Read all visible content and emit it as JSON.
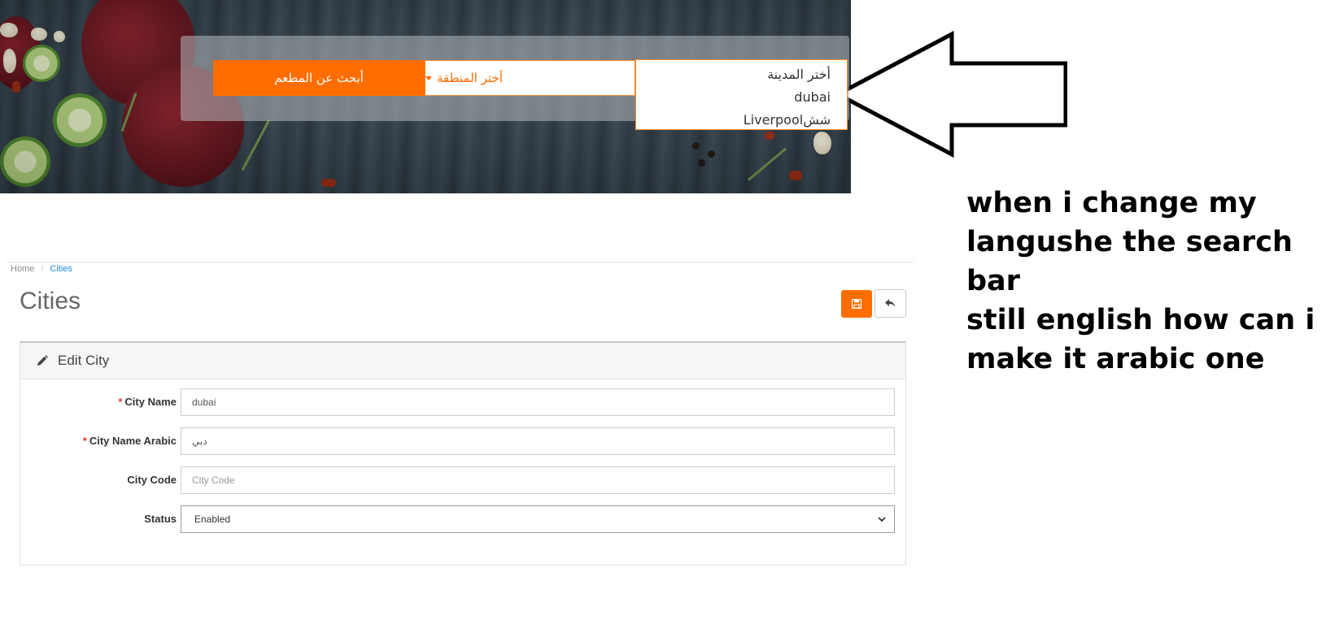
{
  "banner": {
    "search_button": "أبحث عن المطعم",
    "region_select": "أختر المنطقة",
    "city_options": [
      "أختر المدينة",
      "dubai",
      "Liverpoolشش"
    ]
  },
  "note": "when i change my\nlangushe the search bar\nstill english how can i\nmake it arabic one",
  "admin": {
    "breadcrumb": {
      "home": "Home",
      "separator": "/",
      "current": "Cities"
    },
    "page_title": "Cities",
    "panel_title": "Edit City",
    "fields": [
      {
        "label": "City Name",
        "required": "*",
        "value": "dubai",
        "placeholder": ""
      },
      {
        "label": "City Name Arabic",
        "required": "*",
        "value": "دبي",
        "placeholder": ""
      },
      {
        "label": "City Code",
        "required": "",
        "value": "",
        "placeholder": "City Code"
      }
    ],
    "status": {
      "label": "Status",
      "value": "Enabled"
    }
  },
  "colors": {
    "accent": "#ff6d00",
    "link": "#1e88e5",
    "required": "#e53935"
  },
  "icons": [
    "save-icon",
    "reply-icon",
    "pencil-icon",
    "caret-down-icon",
    "chevron-down-icon",
    "arrow-left-icon"
  ]
}
